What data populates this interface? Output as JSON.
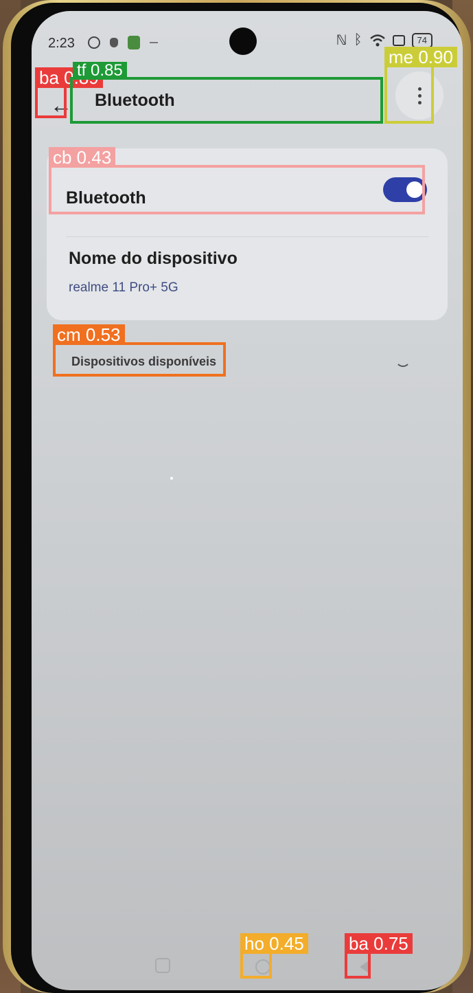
{
  "status_bar": {
    "time": "2:23",
    "battery": "74",
    "icons": [
      "nfc-icon",
      "bluetooth-icon",
      "wifi-icon",
      "sim-icon",
      "battery-icon"
    ]
  },
  "app_bar": {
    "title": "Bluetooth",
    "back_icon": "←",
    "more_icon": "more-vert-icon"
  },
  "settings": {
    "bluetooth_label": "Bluetooth",
    "bluetooth_enabled": true,
    "device_name_title": "Nome do dispositivo",
    "device_name_value": "realme 11 Pro+ 5G",
    "available_devices_title": "Dispositivos disponíveis"
  },
  "detections": [
    {
      "label": "ba 0.89"
    },
    {
      "label": "tf 0.85"
    },
    {
      "label": "me 0.90"
    },
    {
      "label": "cb 0.43"
    },
    {
      "label": "cm 0.53"
    },
    {
      "label": "ho 0.45"
    },
    {
      "label": "ba 0.75"
    }
  ],
  "colors": {
    "accent": "#2e3fa7",
    "link": "#3f4d82",
    "screen_bg": "#d8dbde",
    "card_bg": "#e4e6e9"
  }
}
